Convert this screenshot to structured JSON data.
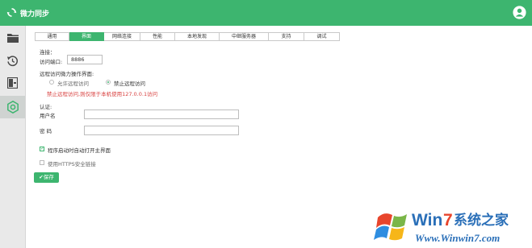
{
  "header": {
    "title": "微力同步"
  },
  "sidebar": {
    "items": [
      "folder-icon",
      "history-icon",
      "device-icon",
      "settings-icon"
    ],
    "active_index": 3
  },
  "tabs": [
    {
      "label": "通用"
    },
    {
      "label": "界面"
    },
    {
      "label": "网络连接"
    },
    {
      "label": "性能"
    },
    {
      "label": "本地发现"
    },
    {
      "label": "中继服务器"
    },
    {
      "label": "支持"
    },
    {
      "label": "调试"
    }
  ],
  "active_tab": 1,
  "connection": {
    "section_label": "连接：",
    "port_label": "访问端口:",
    "port_value": "8886",
    "remote_label": "远程访问微力操作界面:",
    "allow_label": "允许远程访问",
    "deny_label": "禁止远程访问",
    "selected": "deny",
    "warning": "禁止远程访问,则仅限于本机使用127.0.0.1访问"
  },
  "auth": {
    "section_label": "认证:",
    "username_label": "用户名",
    "username_value": "",
    "password_label": "密 码",
    "password_value": ""
  },
  "options": {
    "autostart_label": "程序启动时自动打开主界面",
    "autostart_checked": true,
    "https_label": "使用HTTPS安全链接",
    "https_checked": false
  },
  "save_label": "保存",
  "watermark": {
    "brand": "Win7系统之家",
    "url": "Www.Winwin7.com"
  },
  "colors": {
    "accent": "#3db56f",
    "warning": "#d8403f"
  }
}
